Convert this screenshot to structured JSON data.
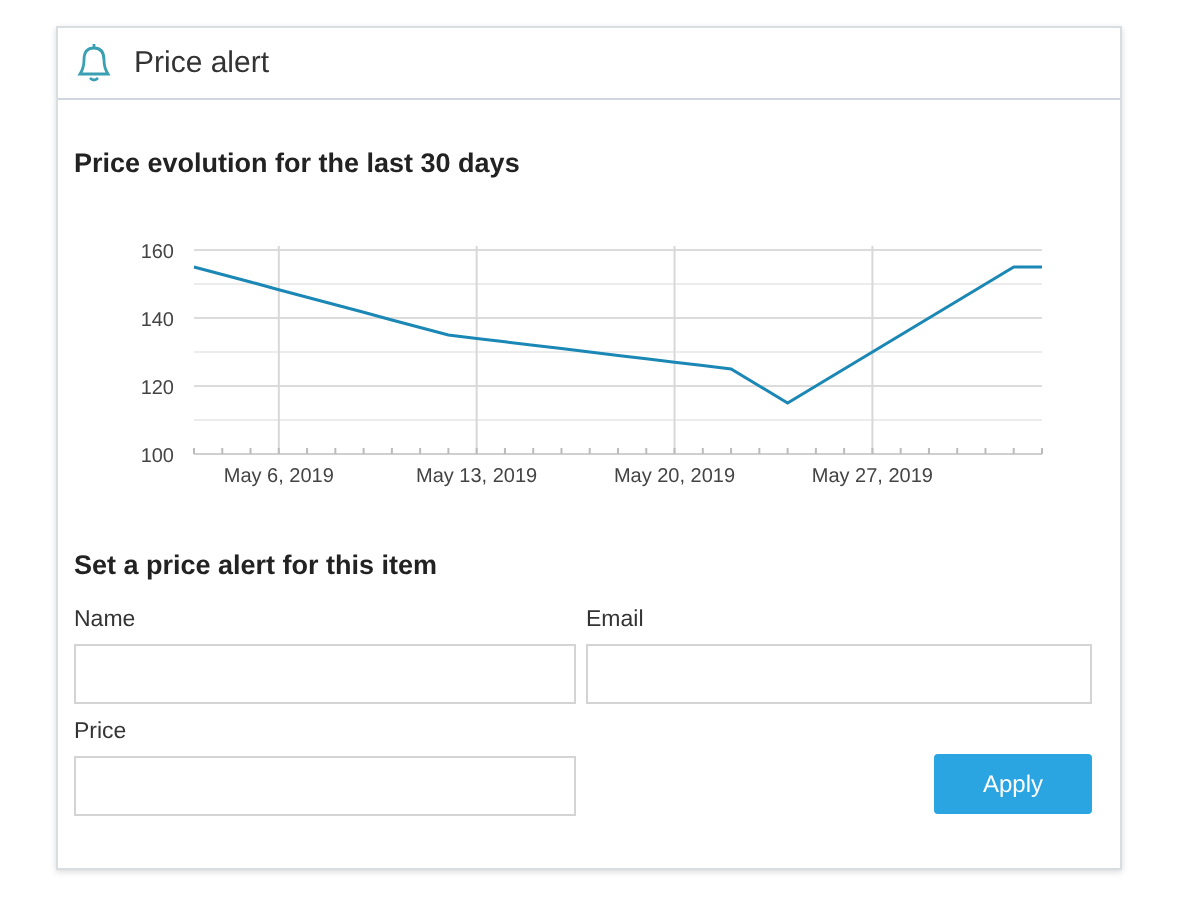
{
  "header": {
    "title": "Price alert"
  },
  "chart": {
    "title": "Price evolution for the last 30 days",
    "chart_data": {
      "type": "line",
      "categories": [
        null,
        null,
        null,
        "May 6, 2019",
        null,
        null,
        null,
        null,
        null,
        null,
        "May 13, 2019",
        null,
        null,
        null,
        null,
        null,
        null,
        "May 20, 2019",
        null,
        null,
        null,
        null,
        null,
        null,
        "May 27, 2019",
        null,
        null,
        null,
        null,
        null,
        null
      ],
      "series": [
        {
          "color": "#1a87b5",
          "values": [
            155,
            152.8,
            150.6,
            148.3,
            146.1,
            143.9,
            141.7,
            139.4,
            137.2,
            135,
            134,
            133,
            132,
            131,
            130,
            129,
            128,
            127,
            126,
            125,
            120,
            115,
            120,
            125,
            130,
            135,
            140,
            145,
            150,
            155,
            155
          ]
        }
      ],
      "ylim": [
        100,
        160
      ],
      "grid": true,
      "yticks": [
        100,
        120,
        140,
        160
      ]
    }
  },
  "form": {
    "title": "Set a price alert for this item",
    "fields": [
      {
        "label": "Name"
      },
      {
        "label": "Email"
      },
      {
        "label": "Price"
      }
    ],
    "button": "Apply"
  }
}
